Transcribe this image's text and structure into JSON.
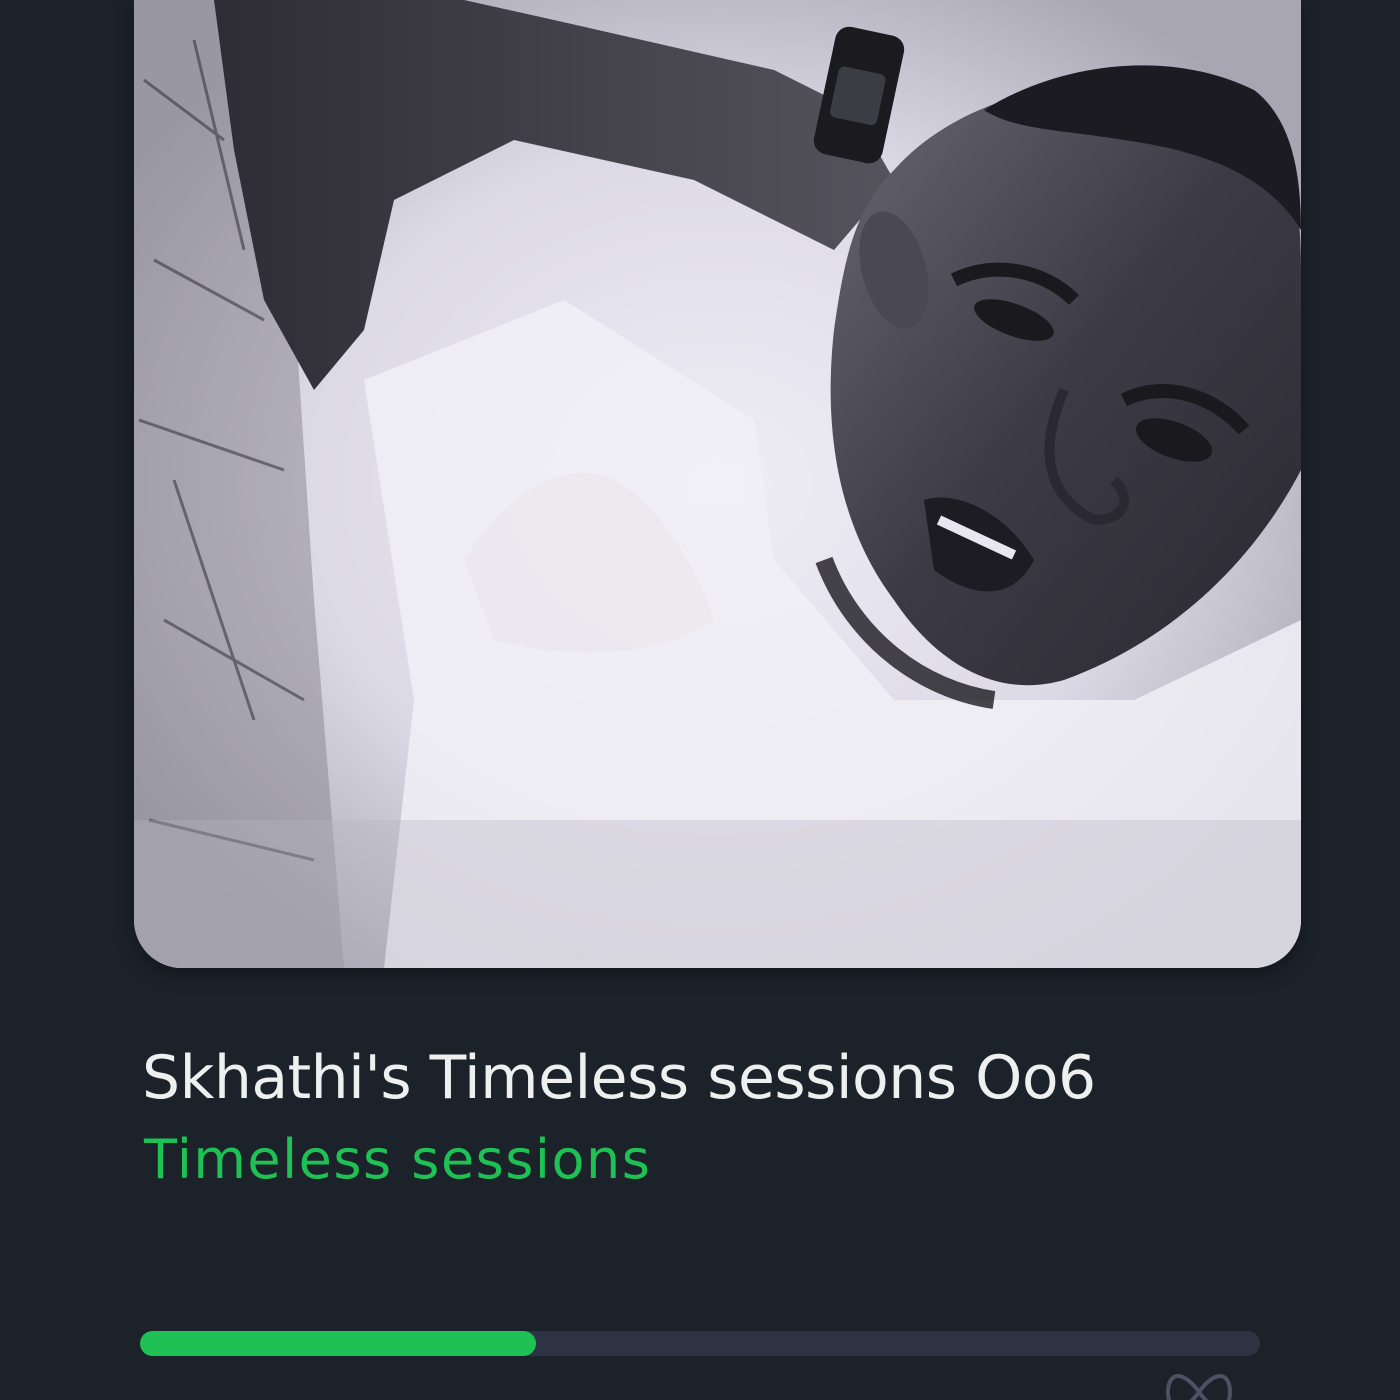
{
  "track": {
    "title": "Skhathi's Timeless sessions Oo6",
    "album": "Timeless sessions"
  },
  "artwork": {
    "icon": "cover-art-image",
    "description_visible": false
  },
  "playback": {
    "progress_percent": 35.4,
    "repeat_icon": "infinity-icon"
  },
  "colors": {
    "background": "#1c222a",
    "accent": "#1ec254",
    "track": "#2c3444",
    "title": "#eef0ef"
  }
}
